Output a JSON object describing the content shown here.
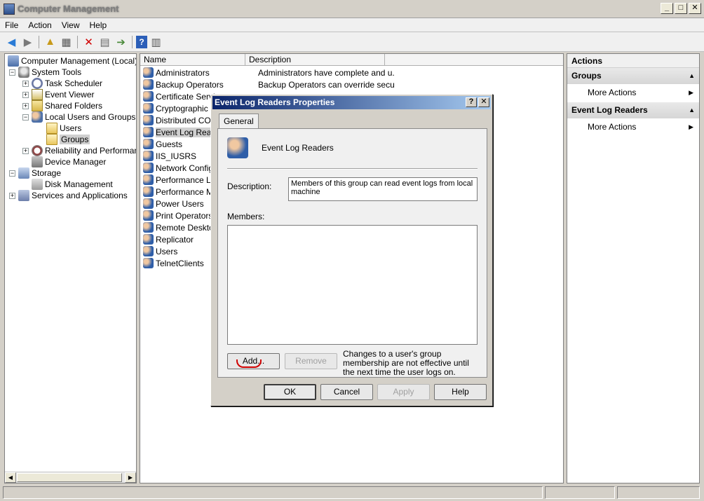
{
  "window": {
    "title": "Computer Management"
  },
  "menu": [
    "File",
    "Action",
    "View",
    "Help"
  ],
  "tree": {
    "items": [
      {
        "label": "Computer Management (Local)",
        "icon": "computer-icon",
        "level": 0,
        "expander": ""
      },
      {
        "label": "System Tools",
        "icon": "tools-icon",
        "level": 1,
        "expander": "−"
      },
      {
        "label": "Task Scheduler",
        "icon": "clock-icon",
        "level": 2,
        "expander": "+"
      },
      {
        "label": "Event Viewer",
        "icon": "event-viewer-icon",
        "level": 2,
        "expander": "+"
      },
      {
        "label": "Shared Folders",
        "icon": "shared-folder-icon",
        "level": 2,
        "expander": "+"
      },
      {
        "label": "Local Users and Groups",
        "icon": "users-icon",
        "level": 2,
        "expander": "−"
      },
      {
        "label": "Users",
        "icon": "folder-icon",
        "level": 3,
        "expander": ""
      },
      {
        "label": "Groups",
        "icon": "folder-icon",
        "level": 3,
        "expander": "",
        "selected": true
      },
      {
        "label": "Reliability and Performanc",
        "icon": "gauge-icon",
        "level": 2,
        "expander": "+"
      },
      {
        "label": "Device Manager",
        "icon": "device-manager-icon",
        "level": 2,
        "expander": ""
      },
      {
        "label": "Storage",
        "icon": "storage-icon",
        "level": 1,
        "expander": "−"
      },
      {
        "label": "Disk Management",
        "icon": "disk-icon",
        "level": 2,
        "expander": ""
      },
      {
        "label": "Services and Applications",
        "icon": "services-icon",
        "level": 1,
        "expander": "+"
      }
    ]
  },
  "list": {
    "columns": [
      "Name",
      "Description"
    ],
    "rows": [
      {
        "name": "Administrators",
        "desc": "Administrators have complete and u..."
      },
      {
        "name": "Backup Operators",
        "desc": "Backup Operators can override secu..."
      },
      {
        "name": "Certificate Servi",
        "desc": ""
      },
      {
        "name": "Cryptographic C",
        "desc": ""
      },
      {
        "name": "Distributed COM",
        "desc": ""
      },
      {
        "name": "Event Log Reade",
        "desc": "",
        "selected": true
      },
      {
        "name": "Guests",
        "desc": ""
      },
      {
        "name": "IIS_IUSRS",
        "desc": ""
      },
      {
        "name": "Network Configu",
        "desc": ""
      },
      {
        "name": "Performance Log",
        "desc": ""
      },
      {
        "name": "Performance Mo",
        "desc": ""
      },
      {
        "name": "Power Users",
        "desc": ""
      },
      {
        "name": "Print Operators",
        "desc": ""
      },
      {
        "name": "Remote Desktop",
        "desc": ""
      },
      {
        "name": "Replicator",
        "desc": ""
      },
      {
        "name": "Users",
        "desc": ""
      },
      {
        "name": "TelnetClients",
        "desc": ""
      }
    ]
  },
  "actions": {
    "header": "Actions",
    "sections": [
      {
        "title": "Groups",
        "items": [
          "More Actions"
        ]
      },
      {
        "title": "Event Log Readers",
        "items": [
          "More Actions"
        ]
      }
    ]
  },
  "dialog": {
    "title": "Event Log Readers Properties",
    "help_btn": "?",
    "close_btn": "✕",
    "tab": "General",
    "group_name": "Event Log Readers",
    "description_label": "Description:",
    "description_value": "Members of this group can read event logs from local machine",
    "members_label": "Members:",
    "add_label": "Add...",
    "remove_label": "Remove",
    "note": "Changes to a user's group membership are not effective until the next time the user logs on.",
    "ok_label": "OK",
    "cancel_label": "Cancel",
    "apply_label": "Apply",
    "help_label": "Help"
  },
  "colors": {
    "dialog_title_start": "#0a246a",
    "dialog_title_end": "#a6caf0",
    "annotation_red": "#d00000"
  }
}
